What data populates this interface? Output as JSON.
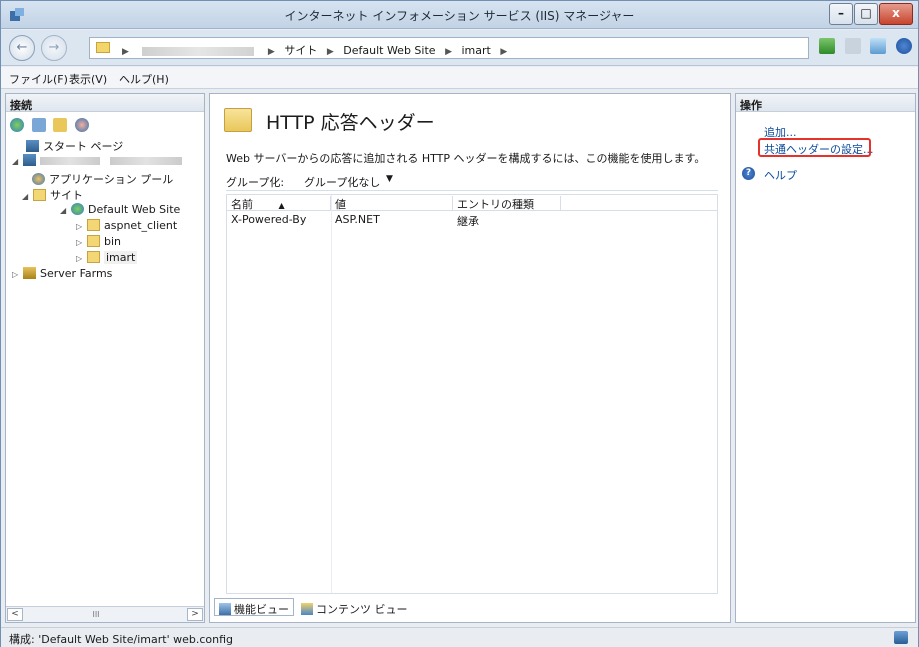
{
  "window": {
    "title": "インターネット インフォメーション サービス (IIS) マネージャー",
    "buttons": {
      "minimize": "–",
      "maximize": "□",
      "close": "x"
    }
  },
  "address": {
    "crumbs": [
      "サイト",
      "Default Web Site",
      "imart"
    ]
  },
  "menu": {
    "items": [
      "ファイル(F)",
      "表示(V)",
      "ヘルプ(H)"
    ]
  },
  "connections": {
    "header": "接続",
    "tree": [
      {
        "label": "スタート ページ"
      },
      {
        "label": ""
      },
      {
        "label": "アプリケーション プール"
      },
      {
        "label": "サイト"
      },
      {
        "label": "Default Web Site"
      },
      {
        "label": "aspnet_client"
      },
      {
        "label": "bin"
      },
      {
        "label": "imart"
      },
      {
        "label": "Server Farms"
      }
    ],
    "scrollbar_thumb": "III"
  },
  "feature": {
    "title": "HTTP 応答ヘッダー",
    "description": "Web サーバーからの応答に追加される HTTP ヘッダーを構成するには、この機能を使用します。",
    "group_label": "グループ化:",
    "group_value": "グループ化なし",
    "columns": [
      "名前",
      "値",
      "エントリの種類"
    ],
    "rows": [
      {
        "name": "X-Powered-By",
        "value": "ASP.NET",
        "type": "継承"
      }
    ],
    "view_tabs": [
      "機能ビュー",
      "コンテンツ ビュー"
    ]
  },
  "actions": {
    "header": "操作",
    "items": [
      "追加...",
      "共通ヘッダーの設定...",
      "ヘルプ"
    ]
  },
  "status": {
    "text": "構成: 'Default Web Site/imart' web.config"
  }
}
